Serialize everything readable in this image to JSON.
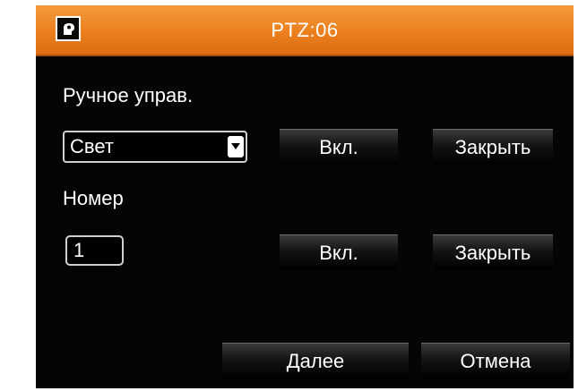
{
  "dialog": {
    "title": "PTZ:06",
    "icon": "camera-icon"
  },
  "manual_control": {
    "label": "Ручное управ.",
    "select_value": "Свет",
    "on_label": "Вкл.",
    "close_label": "Закрыть"
  },
  "number": {
    "label": "Номер",
    "value": "1",
    "on_label": "Вкл.",
    "close_label": "Закрыть"
  },
  "footer": {
    "next_label": "Далее",
    "cancel_label": "Отмена"
  },
  "colors": {
    "titlebar": "#ec7f1e",
    "background": "#050505",
    "text": "#ffffff"
  }
}
